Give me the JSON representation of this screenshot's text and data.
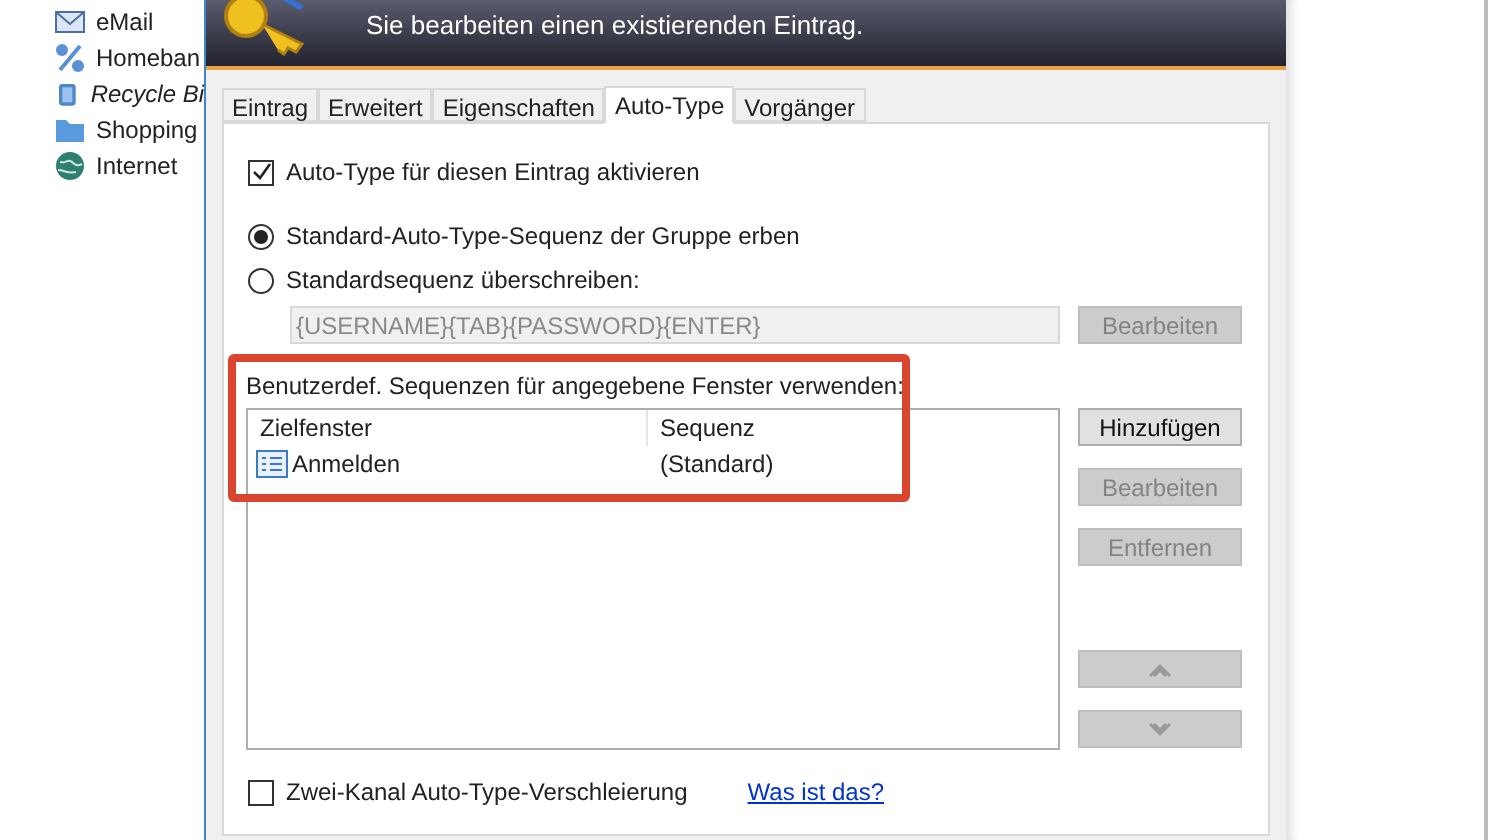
{
  "background_tree": {
    "items": [
      {
        "label": "eMail",
        "kind": "mail",
        "italic": false
      },
      {
        "label": "Homeban",
        "kind": "percent",
        "italic": false
      },
      {
        "label": "Recycle Bi",
        "kind": "bin",
        "italic": true
      },
      {
        "label": "Shopping",
        "kind": "folder",
        "italic": false
      },
      {
        "label": "Internet",
        "kind": "globe",
        "italic": false
      }
    ]
  },
  "dialog": {
    "subtitle": "Sie bearbeiten einen existierenden Eintrag.",
    "tabs": [
      {
        "label": "Eintrag",
        "selected": false
      },
      {
        "label": "Erweitert",
        "selected": false
      },
      {
        "label": "Eigenschaften",
        "selected": false
      },
      {
        "label": "Auto-Type",
        "selected": true
      },
      {
        "label": "Vorgänger",
        "selected": false
      }
    ],
    "enable_autotype": {
      "label": "Auto-Type für diesen Eintrag aktivieren",
      "checked": true
    },
    "radios": [
      {
        "label": "Standard-Auto-Type-Sequenz der Gruppe erben",
        "selected": true
      },
      {
        "label": "Standardsequenz überschreiben:",
        "selected": false
      }
    ],
    "sequence_field": {
      "value": "{USERNAME}{TAB}{PASSWORD}{ENTER}",
      "disabled": true
    },
    "sequence_edit_button": {
      "label": "Bearbeiten",
      "disabled": true
    },
    "custom_label": "Benutzerdef. Sequenzen für angegebene Fenster verwenden:",
    "table": {
      "columns": [
        "Zielfenster",
        "Sequenz"
      ],
      "rows": [
        {
          "cells": [
            "Anmelden",
            "(Standard)"
          ]
        }
      ]
    },
    "side_buttons": [
      {
        "kind": "text",
        "label": "Hinzufügen",
        "disabled": false
      },
      {
        "kind": "text",
        "label": "Bearbeiten",
        "disabled": true
      },
      {
        "kind": "text",
        "label": "Entfernen",
        "disabled": true
      },
      {
        "kind": "up",
        "disabled": true
      },
      {
        "kind": "down",
        "disabled": true
      }
    ],
    "obfuscation": {
      "label": "Zwei-Kanal Auto-Type-Verschleierung",
      "checked": false
    },
    "help_link": "Was ist das?"
  }
}
